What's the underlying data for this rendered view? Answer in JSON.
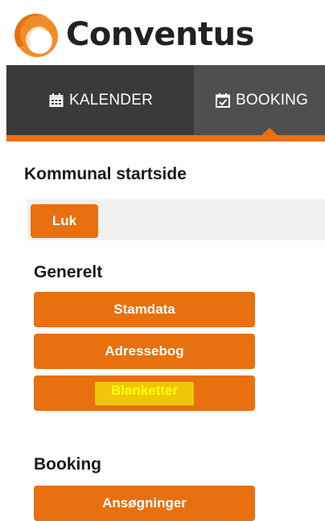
{
  "brand": {
    "name": "Conventus",
    "logo_icon": "conventus-logo-icon",
    "accent_color": "#e8700f"
  },
  "nav": {
    "tabs": [
      {
        "label": "KALENDER",
        "icon": "calendar-icon",
        "active": false
      },
      {
        "label": "BOOKING",
        "icon": "calendar-check-icon",
        "active": true
      }
    ],
    "bar_color": "#3a3a3a"
  },
  "page": {
    "title": "Kommunal startside",
    "close_button": "Luk"
  },
  "sections": {
    "general": {
      "title": "Generelt",
      "items": [
        "Stamdata",
        "Adressebog",
        "Blanketter"
      ],
      "highlighted_item": "Blanketter",
      "highlight_color": "#ffff00"
    },
    "booking": {
      "title": "Booking",
      "items": [
        "Ansøgninger"
      ]
    }
  }
}
